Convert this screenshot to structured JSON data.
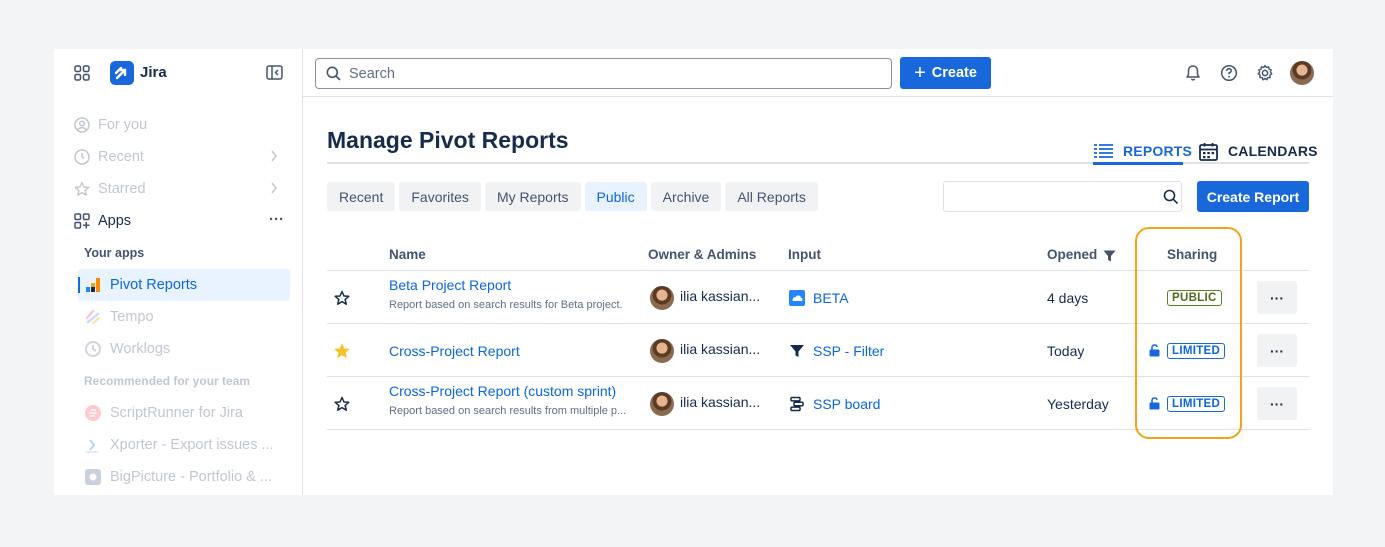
{
  "app": {
    "name": "Jira"
  },
  "sidebar": {
    "items": [
      {
        "label": "For you",
        "icon": "user-circle-icon"
      },
      {
        "label": "Recent",
        "icon": "clock-icon"
      },
      {
        "label": "Starred",
        "icon": "star-icon"
      },
      {
        "label": "Apps",
        "icon": "apps-icon"
      }
    ],
    "your_apps_heading": "Your apps",
    "apps": [
      {
        "label": "Pivot Reports",
        "icon": "pivot-reports-icon"
      },
      {
        "label": "Tempo",
        "icon": "tempo-icon"
      },
      {
        "label": "Worklogs",
        "icon": "worklogs-icon"
      }
    ],
    "recommended_heading": "Recommended for your team",
    "recommended": [
      {
        "label": "ScriptRunner for Jira",
        "icon": "scriptrunner-icon"
      },
      {
        "label": "Xporter - Export issues ...",
        "icon": "xporter-icon"
      },
      {
        "label": "BigPicture - Portfolio & ...",
        "icon": "bigpicture-icon"
      }
    ],
    "more_label": "···"
  },
  "topbar": {
    "search_placeholder": "Search",
    "create_label": "Create",
    "create_plus": "+"
  },
  "page": {
    "title": "Manage Pivot Reports",
    "view_tabs": [
      {
        "label": "REPORTS",
        "active": true
      },
      {
        "label": "CALENDARS",
        "active": false
      }
    ],
    "filters": [
      "Recent",
      "Favorites",
      "My Reports",
      "Public",
      "Archive",
      "All Reports"
    ],
    "active_filter": "Public",
    "create_report_label": "Create Report"
  },
  "table": {
    "columns": [
      "Name",
      "Owner & Admins",
      "Input",
      "Opened",
      "Sharing"
    ],
    "rows": [
      {
        "starred": false,
        "name": "Beta Project Report",
        "description": "Report based on search results for Beta project.",
        "owner": "ilia kassian...",
        "input": "BETA",
        "input_icon": "cloud-project-icon",
        "opened": "4 days",
        "sharing": "PUBLIC",
        "more": "···"
      },
      {
        "starred": true,
        "name": "Cross-Project Report",
        "description": "",
        "owner": "ilia kassian...",
        "input": "SSP - Filter",
        "input_icon": "filter-icon",
        "opened": "Today",
        "sharing": "LIMITED",
        "more": "···"
      },
      {
        "starred": false,
        "name": "Cross-Project Report (custom sprint)",
        "description": "Report based on search results from multiple p...",
        "owner": "ilia kassian...",
        "input": "SSP board",
        "input_icon": "board-icon",
        "opened": "Yesterday",
        "sharing": "LIMITED",
        "more": "···"
      }
    ]
  },
  "colors": {
    "accent": "#1868db",
    "public_badge": "#4c6b1f",
    "highlight": "#f5a21b",
    "star_filled": "#f5c22a"
  }
}
